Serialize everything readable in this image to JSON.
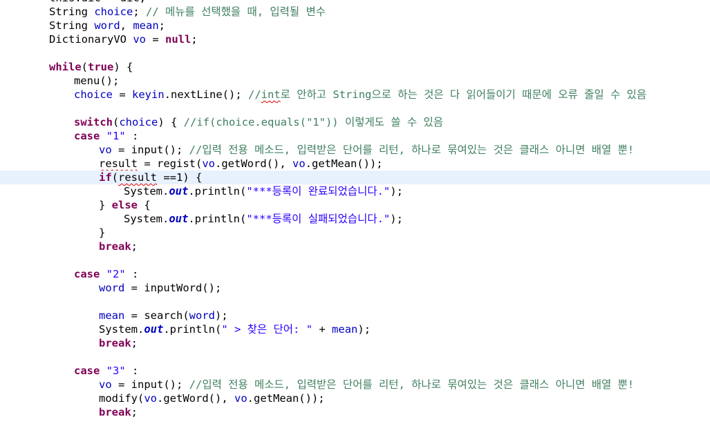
{
  "editor": {
    "language": "java",
    "current_line_index": 13,
    "colors": {
      "keyword": "#7f0055",
      "field": "#0000c0",
      "string": "#2a00ff",
      "comment": "#3f7f5f",
      "current_line_bg": "#e8f2fe",
      "spellcheck_underline": "#e00000"
    },
    "lines": [
      {
        "indent": 0,
        "tokens": [
          {
            "t": "this.dic = dic;",
            "c": "plain"
          }
        ]
      },
      {
        "indent": 0,
        "tokens": [
          {
            "t": "String ",
            "c": "plain"
          },
          {
            "t": "choice",
            "c": "fld"
          },
          {
            "t": "; ",
            "c": "plain"
          },
          {
            "t": "// 메뉴를 선택했을 때, 입력될 변수",
            "c": "cm"
          }
        ]
      },
      {
        "indent": 0,
        "tokens": [
          {
            "t": "String ",
            "c": "plain"
          },
          {
            "t": "word",
            "c": "fld"
          },
          {
            "t": ", ",
            "c": "plain"
          },
          {
            "t": "mean",
            "c": "fld"
          },
          {
            "t": ";",
            "c": "plain"
          }
        ]
      },
      {
        "indent": 0,
        "tokens": [
          {
            "t": "DictionaryVO ",
            "c": "plain"
          },
          {
            "t": "vo",
            "c": "fld"
          },
          {
            "t": " = ",
            "c": "plain"
          },
          {
            "t": "null",
            "c": "kw"
          },
          {
            "t": ";",
            "c": "plain"
          }
        ]
      },
      {
        "indent": 0,
        "tokens": []
      },
      {
        "indent": 0,
        "tokens": [
          {
            "t": "while",
            "c": "kw"
          },
          {
            "t": "(",
            "c": "plain"
          },
          {
            "t": "true",
            "c": "kw"
          },
          {
            "t": ") {",
            "c": "plain"
          }
        ]
      },
      {
        "indent": 1,
        "tokens": [
          {
            "t": "menu();",
            "c": "plain"
          }
        ]
      },
      {
        "indent": 1,
        "tokens": [
          {
            "t": "choice",
            "c": "fld"
          },
          {
            "t": " = ",
            "c": "plain"
          },
          {
            "t": "keyin",
            "c": "fld"
          },
          {
            "t": ".nextLine(); ",
            "c": "plain"
          },
          {
            "t": "//",
            "c": "cm"
          },
          {
            "t": "int",
            "c": "cm squig"
          },
          {
            "t": "로 안하고 String으로 하는 것은 다 읽어들이기 때문에 오류 줄일 수 있음",
            "c": "cm"
          }
        ]
      },
      {
        "indent": 0,
        "tokens": []
      },
      {
        "indent": 1,
        "tokens": [
          {
            "t": "switch",
            "c": "kw"
          },
          {
            "t": "(",
            "c": "plain"
          },
          {
            "t": "choice",
            "c": "fld"
          },
          {
            "t": ") { ",
            "c": "plain"
          },
          {
            "t": "//if(choice.equals(\"1\")) 이렇게도 쓸 수 있음",
            "c": "cm"
          }
        ]
      },
      {
        "indent": 1,
        "tokens": [
          {
            "t": "case",
            "c": "kw"
          },
          {
            "t": " ",
            "c": "plain"
          },
          {
            "t": "\"1\"",
            "c": "str"
          },
          {
            "t": " :",
            "c": "plain"
          }
        ]
      },
      {
        "indent": 2,
        "tokens": [
          {
            "t": "vo",
            "c": "fld"
          },
          {
            "t": " = input(); ",
            "c": "plain"
          },
          {
            "t": "//입력 전용 메소드, 입력받은 단어를 리턴, 하나로 묶여있는 것은 클래스 아니면 배열 뿐!",
            "c": "cm"
          }
        ]
      },
      {
        "indent": 2,
        "tokens": [
          {
            "t": "result",
            "c": "plain squig"
          },
          {
            "t": " = regist(",
            "c": "plain"
          },
          {
            "t": "vo",
            "c": "fld"
          },
          {
            "t": ".getWord(), ",
            "c": "plain"
          },
          {
            "t": "vo",
            "c": "fld"
          },
          {
            "t": ".getMean());",
            "c": "plain"
          }
        ]
      },
      {
        "indent": 2,
        "tokens": [
          {
            "t": "if",
            "c": "kw"
          },
          {
            "t": "(",
            "c": "plain"
          },
          {
            "t": "result",
            "c": "plain squig"
          },
          {
            "t": " ==1) {",
            "c": "plain"
          }
        ]
      },
      {
        "indent": 3,
        "tokens": [
          {
            "t": "System.",
            "c": "plain"
          },
          {
            "t": "out",
            "c": "sfld"
          },
          {
            "t": ".println(",
            "c": "plain"
          },
          {
            "t": "\"***등록이 완료되었습니다.\"",
            "c": "str"
          },
          {
            "t": ");",
            "c": "plain"
          }
        ]
      },
      {
        "indent": 2,
        "tokens": [
          {
            "t": "} ",
            "c": "plain"
          },
          {
            "t": "else",
            "c": "kw"
          },
          {
            "t": " {",
            "c": "plain"
          }
        ]
      },
      {
        "indent": 3,
        "tokens": [
          {
            "t": "System.",
            "c": "plain"
          },
          {
            "t": "out",
            "c": "sfld"
          },
          {
            "t": ".println(",
            "c": "plain"
          },
          {
            "t": "\"***등록이 실패되었습니다.\"",
            "c": "str"
          },
          {
            "t": ");",
            "c": "plain"
          }
        ]
      },
      {
        "indent": 2,
        "tokens": [
          {
            "t": "}",
            "c": "plain"
          }
        ]
      },
      {
        "indent": 2,
        "tokens": [
          {
            "t": "break",
            "c": "kw"
          },
          {
            "t": ";",
            "c": "plain"
          }
        ]
      },
      {
        "indent": 0,
        "tokens": []
      },
      {
        "indent": 1,
        "tokens": [
          {
            "t": "case",
            "c": "kw"
          },
          {
            "t": " ",
            "c": "plain"
          },
          {
            "t": "\"2\"",
            "c": "str"
          },
          {
            "t": " :",
            "c": "plain"
          }
        ]
      },
      {
        "indent": 2,
        "tokens": [
          {
            "t": "word",
            "c": "fld"
          },
          {
            "t": " = inputWord();",
            "c": "plain"
          }
        ]
      },
      {
        "indent": 0,
        "tokens": []
      },
      {
        "indent": 2,
        "tokens": [
          {
            "t": "mean",
            "c": "fld"
          },
          {
            "t": " = search(",
            "c": "plain"
          },
          {
            "t": "word",
            "c": "fld"
          },
          {
            "t": ");",
            "c": "plain"
          }
        ]
      },
      {
        "indent": 2,
        "tokens": [
          {
            "t": "System.",
            "c": "plain"
          },
          {
            "t": "out",
            "c": "sfld"
          },
          {
            "t": ".println(",
            "c": "plain"
          },
          {
            "t": "\" > 찾은 단어: \"",
            "c": "str"
          },
          {
            "t": " + ",
            "c": "plain"
          },
          {
            "t": "mean",
            "c": "fld"
          },
          {
            "t": ");",
            "c": "plain"
          }
        ]
      },
      {
        "indent": 2,
        "tokens": [
          {
            "t": "break",
            "c": "kw"
          },
          {
            "t": ";",
            "c": "plain"
          }
        ]
      },
      {
        "indent": 0,
        "tokens": []
      },
      {
        "indent": 1,
        "tokens": [
          {
            "t": "case",
            "c": "kw"
          },
          {
            "t": " ",
            "c": "plain"
          },
          {
            "t": "\"3\"",
            "c": "str"
          },
          {
            "t": " :",
            "c": "plain"
          }
        ]
      },
      {
        "indent": 2,
        "tokens": [
          {
            "t": "vo",
            "c": "fld"
          },
          {
            "t": " = input(); ",
            "c": "plain"
          },
          {
            "t": "//입력 전용 메소드, 입력받은 단어를 리턴, 하나로 묶여있는 것은 클래스 아니면 배열 뿐!",
            "c": "cm"
          }
        ]
      },
      {
        "indent": 2,
        "tokens": [
          {
            "t": "modify(",
            "c": "plain"
          },
          {
            "t": "vo",
            "c": "fld"
          },
          {
            "t": ".getWord(), ",
            "c": "plain"
          },
          {
            "t": "vo",
            "c": "fld"
          },
          {
            "t": ".getMean());",
            "c": "plain"
          }
        ]
      },
      {
        "indent": 2,
        "tokens": [
          {
            "t": "break",
            "c": "kw"
          },
          {
            "t": ";",
            "c": "plain"
          }
        ]
      }
    ]
  }
}
